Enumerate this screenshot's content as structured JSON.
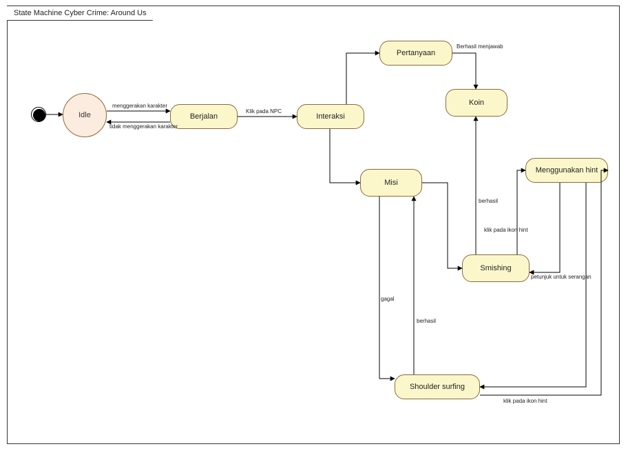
{
  "diagram": {
    "title": "State Machine Cyber Crime: Around Us",
    "states": {
      "idle": "Idle",
      "berjalan": "Berjalan",
      "interaksi": "Interaksi",
      "pertanyaan": "Pertanyaan",
      "misi": "Misi",
      "koin": "Koin",
      "smishing": "Smishing",
      "shoulder": "Shoulder surfing",
      "hint": "Menggunakan hint"
    },
    "transitions": {
      "menggerakan": "menggerakan karakter",
      "tidak_menggerakan": "tidak menggerakan karakter",
      "klik_npc": "Klik pada NPC",
      "berhasil_menjawab": "Berhasil menjawab",
      "berhasil1": "berhasil",
      "berhasil2": "berhasil",
      "gagal": "gagal",
      "klik_hint1": "klik pada ikon hint",
      "klik_hint2": "klik pada ikon hint",
      "petunjuk": "petunjuk untuk serangan"
    }
  }
}
